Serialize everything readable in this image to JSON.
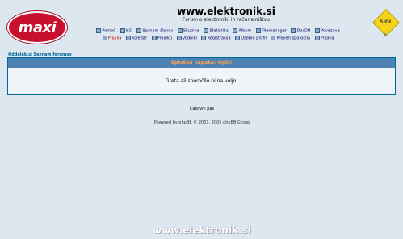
{
  "header": {
    "logo_left": "maxi",
    "logo_right": "SIOL",
    "title": "www.elektronik.si",
    "description": "Forum o elektroniki in računalništvu"
  },
  "nav": {
    "row1": [
      {
        "label": "Pomoč",
        "icon": "help-icon"
      },
      {
        "label": "Išči",
        "icon": "search-icon"
      },
      {
        "label": "Seznam članov",
        "icon": "members-icon"
      },
      {
        "label": "Skupine",
        "icon": "groups-icon"
      },
      {
        "label": "Statistika",
        "icon": "stats-icon"
      },
      {
        "label": "Album",
        "icon": "album-icon"
      },
      {
        "label": "Filemanager",
        "icon": "filemanager-icon"
      },
      {
        "label": "DocDB",
        "icon": "docdb-icon"
      },
      {
        "label": "Povezave",
        "icon": "links-icon"
      }
    ],
    "row2": [
      {
        "label": "Pravila",
        "icon": "rules-icon",
        "color": "#cc0000"
      },
      {
        "label": "Koledar",
        "icon": "calendar-icon"
      },
      {
        "label": "Projekti",
        "icon": "projects-icon"
      },
      {
        "label": "Vodniki",
        "icon": "guides-icon"
      },
      {
        "label": "Registracija",
        "icon": "register-icon"
      },
      {
        "label": "Osebni profil",
        "icon": "profile-icon"
      },
      {
        "label": "Preveri sporočila",
        "icon": "messages-icon"
      },
      {
        "label": "Prijava",
        "icon": "login-icon"
      }
    ]
  },
  "breadcrumb": "Oddelek.si Seznam forumov",
  "message": {
    "header": "Splošna napaka: Opis!",
    "body": "Greta ali sporočilo ni na voljo."
  },
  "timezone": "Časovni pas",
  "powered": "Powered by phpBB © 2001, 2005 phpBB Group",
  "footer_site": "www.elektronik.si",
  "colors": {
    "background": "#dde7ef",
    "message_header": "#4d83b3",
    "message_title": "#ffa34f",
    "border": "#006699",
    "maxi_red": "#c8102e",
    "siol_yellow": "#f4d31a"
  }
}
